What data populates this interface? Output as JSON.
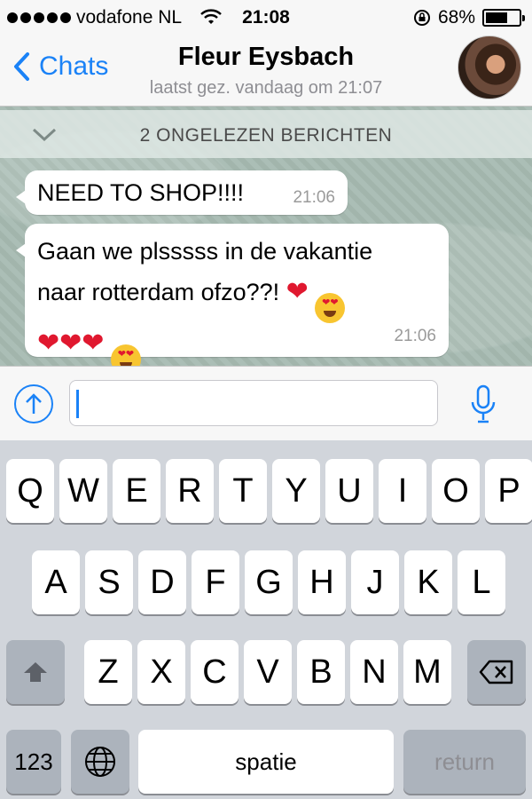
{
  "status": {
    "carrier": "vodafone NL",
    "time": "21:08",
    "battery": "68%",
    "battery_level": 0.68
  },
  "nav": {
    "back_label": "Chats",
    "title": "Fleur Eysbach",
    "subtitle": "laatst gez. vandaag om 21:07"
  },
  "unread_banner": "2 ONGELEZEN BERICHTEN",
  "messages": [
    {
      "text": "NEED TO SHOP!!!!",
      "time": "21:06"
    },
    {
      "line1": "Gaan we plsssss in de vakantie",
      "line2": "naar rotterdam ofzo??!",
      "time": "21:06"
    }
  ],
  "input": {
    "value": "",
    "placeholder": ""
  },
  "keyboard": {
    "row1": [
      "Q",
      "W",
      "E",
      "R",
      "T",
      "Y",
      "U",
      "I",
      "O",
      "P"
    ],
    "row2": [
      "A",
      "S",
      "D",
      "F",
      "G",
      "H",
      "J",
      "K",
      "L"
    ],
    "row3": [
      "Z",
      "X",
      "C",
      "V",
      "B",
      "N",
      "M"
    ],
    "numbers_label": "123",
    "space_label": "spatie",
    "return_label": "return"
  },
  "colors": {
    "accent": "#1a82f7",
    "heart": "#e0182f"
  }
}
